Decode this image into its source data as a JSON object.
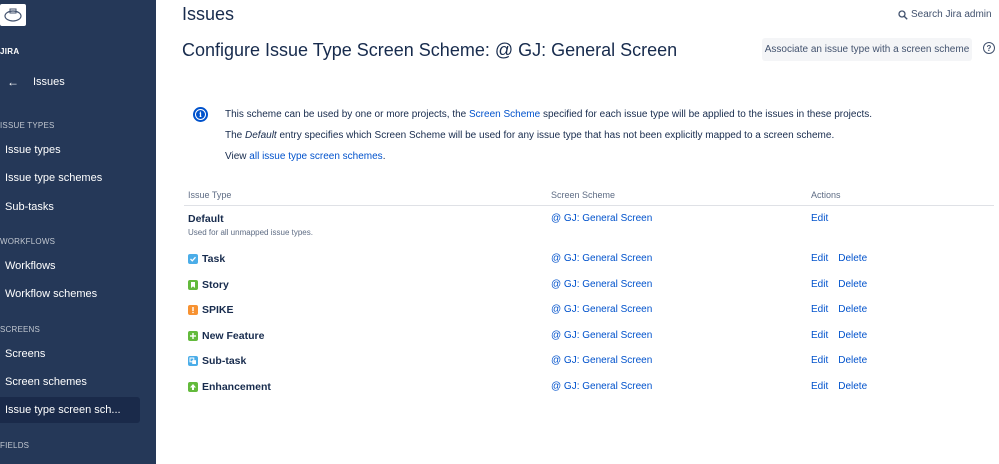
{
  "sidebar": {
    "project_name": "JIRA",
    "back_label": "Issues",
    "sections": [
      {
        "title": "ISSUE TYPES",
        "items": [
          "Issue types",
          "Issue type schemes",
          "Sub-tasks"
        ]
      },
      {
        "title": "WORKFLOWS",
        "items": [
          "Workflows",
          "Workflow schemes"
        ]
      },
      {
        "title": "SCREENS",
        "items": [
          "Screens",
          "Screen schemes",
          "Issue type screen sch..."
        ]
      },
      {
        "title": "FIELDS",
        "items": []
      }
    ],
    "active_item": "Issue type screen sch..."
  },
  "header": {
    "title": "Issues",
    "search_label": "Search Jira admin"
  },
  "main": {
    "heading": "Configure Issue Type Screen Scheme: @ GJ: General Screen",
    "associate_button": "Associate an issue type with a screen scheme",
    "help_symbol": "?",
    "info": {
      "line1_pre": "This scheme can be used by one or more projects, the ",
      "line1_link": "Screen Scheme",
      "line1_post": " specified for each issue type will be applied to the issues in these projects.",
      "line2_pre": "The ",
      "line2_em": "Default",
      "line2_post": " entry specifies which Screen Scheme will be used for any issue type that has not been explicitly mapped to a screen scheme.",
      "line3_pre": "View ",
      "line3_link": "all issue type screen schemes",
      "line3_post": "."
    },
    "table": {
      "headers": [
        "Issue Type",
        "Screen Scheme",
        "Actions"
      ],
      "rows": [
        {
          "type": "Default",
          "subtitle": "Used for all unmapped issue types.",
          "icon": "none",
          "scheme": "@ GJ: General Screen",
          "edit": "Edit",
          "delete": ""
        },
        {
          "type": "Task",
          "icon": "task-icon",
          "icon_color": "#4bade8",
          "scheme": "@ GJ: General Screen",
          "edit": "Edit",
          "delete": "Delete"
        },
        {
          "type": "Story",
          "icon": "story-icon",
          "icon_color": "#63ba3c",
          "scheme": "@ GJ: General Screen",
          "edit": "Edit",
          "delete": "Delete"
        },
        {
          "type": "SPIKE",
          "icon": "spike-icon",
          "icon_color": "#f79232",
          "scheme": "@ GJ: General Screen",
          "edit": "Edit",
          "delete": "Delete"
        },
        {
          "type": "New Feature",
          "icon": "new-feature-icon",
          "icon_color": "#63ba3c",
          "scheme": "@ GJ: General Screen",
          "edit": "Edit",
          "delete": "Delete"
        },
        {
          "type": "Sub-task",
          "icon": "sub-task-icon",
          "icon_color": "#4bade8",
          "scheme": "@ GJ: General Screen",
          "edit": "Edit",
          "delete": "Delete"
        },
        {
          "type": "Enhancement",
          "icon": "enhancement-icon",
          "icon_color": "#63ba3c",
          "scheme": "@ GJ: General Screen",
          "edit": "Edit",
          "delete": "Delete"
        }
      ]
    }
  }
}
